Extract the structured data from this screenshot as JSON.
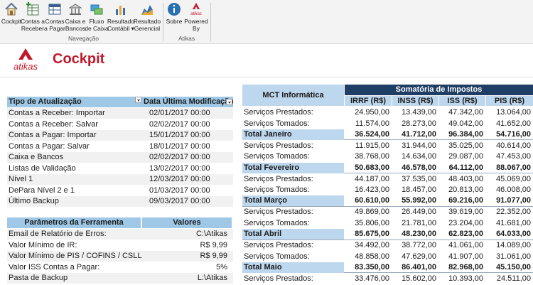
{
  "ribbon": {
    "buttons": [
      {
        "id": "cockpit",
        "label": "Cockpit"
      },
      {
        "id": "contas-receber",
        "label": "Contas a\nReceber"
      },
      {
        "id": "contas-pagar",
        "label": "Contas\na Pagar"
      },
      {
        "id": "caixa-bancos",
        "label": "Caixa e\nBancos"
      },
      {
        "id": "fluxo-caixa",
        "label": "Fluxo\nde Caixa"
      },
      {
        "id": "resultado-contabil",
        "label": "Resultado\nContábil ▾"
      },
      {
        "id": "resultado-gerencial",
        "label": "Resultado\nGerencial"
      },
      {
        "id": "sobre",
        "label": "Sobre"
      },
      {
        "id": "powered-by",
        "label": "Powered\nBy"
      }
    ],
    "groups": {
      "navegacao": "Navegação",
      "atikas": "Atikas"
    },
    "logo_small": "atikas"
  },
  "header": {
    "logo_text": "atikas",
    "title": "Cockpit"
  },
  "update_table": {
    "col1": "Tipo de Atualização",
    "col2": "Data Última Modificação",
    "rows": [
      {
        "tipo": "Contas a Receber: Importar",
        "data": "02/01/2017 00:00"
      },
      {
        "tipo": "Contas a Receber: Salvar",
        "data": "02/02/2017 00:00"
      },
      {
        "tipo": "Contas a Pagar: Importar",
        "data": "15/01/2017 00:00"
      },
      {
        "tipo": "Contas a Pagar: Salvar",
        "data": "18/01/2017 00:00"
      },
      {
        "tipo": "Caixa e Bancos",
        "data": "02/02/2017 00:00"
      },
      {
        "tipo": "Listas de Validação",
        "data": "13/02/2017 00:00"
      },
      {
        "tipo": "Nível 1",
        "data": "12/03/2017 00:00"
      },
      {
        "tipo": "DePara Nível 2 e 1",
        "data": "01/03/2017 00:00"
      },
      {
        "tipo": "Último Backup",
        "data": "09/03/2017 00:00"
      }
    ]
  },
  "params_table": {
    "col1": "Parâmetros da Ferramenta",
    "col2": "Valores",
    "rows": [
      {
        "param": "Email de Relatório de Erros:",
        "valor": "C:\\Atikas"
      },
      {
        "param": "Valor Mínimo de IR:",
        "valor": "R$ 9,99"
      },
      {
        "param": "Valor Mínimo de PIS / COFINS / CSLL:",
        "valor": "R$ 9,99"
      },
      {
        "param": "Valor ISS Contas a Pagar:",
        "valor": "5%"
      },
      {
        "param": "Pasta de Backup",
        "valor": "L:\\Atikas"
      }
    ]
  },
  "tax_table": {
    "company": "MCT Informática",
    "group_header": "Somatória de Impostos",
    "columns": [
      "IRRF (R$)",
      "INSS (R$)",
      "ISS (R$)",
      "PIS (R$)"
    ],
    "rows": [
      {
        "label": "Serviços Prestados:",
        "values": [
          "24.950,00",
          "13.439,00",
          "47.342,00",
          "13.064,00"
        ],
        "total": false
      },
      {
        "label": "Serviços Tomados:",
        "values": [
          "11.574,00",
          "28.273,00",
          "49.042,00",
          "41.652,00"
        ],
        "total": false
      },
      {
        "label": "Total Janeiro",
        "values": [
          "36.524,00",
          "41.712,00",
          "96.384,00",
          "54.716,00"
        ],
        "total": true
      },
      {
        "label": "Serviços Prestados:",
        "values": [
          "11.915,00",
          "31.944,00",
          "35.025,00",
          "40.614,00"
        ],
        "total": false
      },
      {
        "label": "Serviços Tomados:",
        "values": [
          "38.768,00",
          "14.634,00",
          "29.087,00",
          "47.453,00"
        ],
        "total": false
      },
      {
        "label": "Total Fevereiro",
        "values": [
          "50.683,00",
          "46.578,00",
          "64.112,00",
          "88.067,00"
        ],
        "total": true
      },
      {
        "label": "Serviços Prestados:",
        "values": [
          "44.187,00",
          "37.535,00",
          "48.403,00",
          "45.069,00"
        ],
        "total": false
      },
      {
        "label": "Serviços Tomados:",
        "values": [
          "16.423,00",
          "18.457,00",
          "20.813,00",
          "46.008,00"
        ],
        "total": false
      },
      {
        "label": "Total Março",
        "values": [
          "60.610,00",
          "55.992,00",
          "69.216,00",
          "91.077,00"
        ],
        "total": true
      },
      {
        "label": "Serviços Prestados:",
        "values": [
          "49.869,00",
          "26.449,00",
          "39.619,00",
          "22.352,00"
        ],
        "total": false
      },
      {
        "label": "Serviços Tomados:",
        "values": [
          "35.806,00",
          "21.781,00",
          "23.204,00",
          "41.681,00"
        ],
        "total": false
      },
      {
        "label": "Total Abril",
        "values": [
          "85.675,00",
          "48.230,00",
          "62.823,00",
          "64.033,00"
        ],
        "total": true
      },
      {
        "label": "Serviços Prestados:",
        "values": [
          "34.492,00",
          "38.772,00",
          "41.061,00",
          "14.089,00"
        ],
        "total": false
      },
      {
        "label": "Serviços Tomados:",
        "values": [
          "48.858,00",
          "47.629,00",
          "41.907,00",
          "31.061,00"
        ],
        "total": false
      },
      {
        "label": "Total Maio",
        "values": [
          "83.350,00",
          "86.401,00",
          "82.968,00",
          "45.150,00"
        ],
        "total": true
      },
      {
        "label": "Serviços Prestados:",
        "values": [
          "33.476,00",
          "15.602,00",
          "10.393,00",
          "24.511,00"
        ],
        "total": false
      }
    ]
  },
  "colors": {
    "brand": "#c0192b",
    "dark_header": "#1f3e66",
    "light_header": "#bdd7ee",
    "left_header": "#9ec8e6"
  }
}
